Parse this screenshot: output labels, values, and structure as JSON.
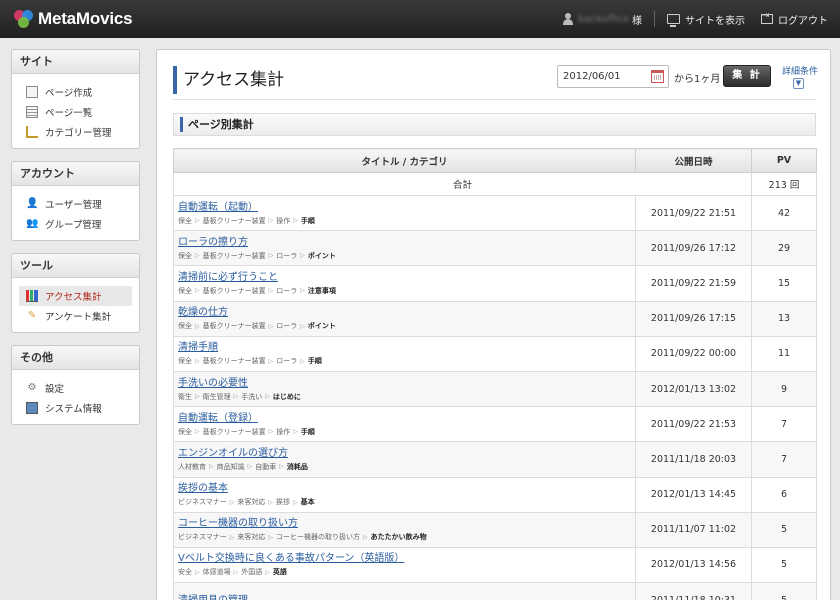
{
  "app": {
    "name": "MetaMovics"
  },
  "header": {
    "username": "backoffice",
    "honorific": "様",
    "view_site": "サイトを表示",
    "logout": "ログアウト"
  },
  "sidebar": [
    {
      "title": "サイト",
      "items": [
        {
          "label": "ページ作成",
          "icon": "page-icon"
        },
        {
          "label": "ページ一覧",
          "icon": "page-list-icon"
        },
        {
          "label": "カテゴリー管理",
          "icon": "category-icon"
        }
      ]
    },
    {
      "title": "アカウント",
      "items": [
        {
          "label": "ユーザー管理",
          "icon": "user-icon"
        },
        {
          "label": "グループ管理",
          "icon": "group-icon"
        }
      ]
    },
    {
      "title": "ツール",
      "items": [
        {
          "label": "アクセス集計",
          "icon": "chart-icon",
          "active": true
        },
        {
          "label": "アンケート集計",
          "icon": "survey-icon"
        }
      ]
    },
    {
      "title": "その他",
      "items": [
        {
          "label": "設定",
          "icon": "gear-icon"
        },
        {
          "label": "システム情報",
          "icon": "system-info-icon"
        }
      ]
    }
  ],
  "main": {
    "title": "アクセス集計",
    "date_value": "2012/06/01",
    "period_label": "から1ヶ月",
    "aggregate_button": "集 計",
    "detail_link": "詳細条件",
    "section_title": "ページ別集計",
    "table": {
      "headers": {
        "title": "タイトル / カテゴリ",
        "date": "公開日時",
        "pv": "PV"
      },
      "total_label": "合計",
      "total_value": "213 回",
      "rows": [
        {
          "title": "自動運転（起動）",
          "crumbs": [
            "保全",
            "基板クリーナー装置",
            "操作",
            "手順"
          ],
          "date": "2011/09/22 21:51",
          "pv": "42"
        },
        {
          "title": "ローラの擦り方",
          "crumbs": [
            "保全",
            "基板クリーナー装置",
            "ローラ",
            "ポイント"
          ],
          "date": "2011/09/26 17:12",
          "pv": "29"
        },
        {
          "title": "清掃前に必ず行うこと",
          "crumbs": [
            "保全",
            "基板クリーナー装置",
            "ローラ",
            "注意事項"
          ],
          "date": "2011/09/22 21:59",
          "pv": "15"
        },
        {
          "title": "乾燥の仕方",
          "crumbs": [
            "保全",
            "基板クリーナー装置",
            "ローラ",
            "ポイント"
          ],
          "date": "2011/09/26 17:15",
          "pv": "13"
        },
        {
          "title": "清掃手順",
          "crumbs": [
            "保全",
            "基板クリーナー装置",
            "ローラ",
            "手順"
          ],
          "date": "2011/09/22 00:00",
          "pv": "11"
        },
        {
          "title": "手洗いの必要性",
          "crumbs": [
            "衛生",
            "衛生管理",
            "手洗い",
            "はじめに"
          ],
          "date": "2012/01/13 13:02",
          "pv": "9"
        },
        {
          "title": "自動運転（登録）",
          "crumbs": [
            "保全",
            "基板クリーナー装置",
            "操作",
            "手順"
          ],
          "date": "2011/09/22 21:53",
          "pv": "7"
        },
        {
          "title": "エンジンオイルの選び方",
          "crumbs": [
            "人材教育",
            "商品知識",
            "自動車",
            "消耗品"
          ],
          "date": "2011/11/18 20:03",
          "pv": "7"
        },
        {
          "title": "挨拶の基本",
          "crumbs": [
            "ビジネスマナー",
            "来客対応",
            "挨拶",
            "基本"
          ],
          "date": "2012/01/13 14:45",
          "pv": "6"
        },
        {
          "title": "コーヒー機器の取り扱い方",
          "crumbs": [
            "ビジネスマナー",
            "来客対応",
            "コーヒー機器の取り扱い方",
            "あたたかい飲み物"
          ],
          "date": "2011/11/07 11:02",
          "pv": "5"
        },
        {
          "title": "Vベルト交換時に良くある事故パターン（英語版）",
          "crumbs": [
            "安全",
            "体感道場",
            "外国語",
            "英語"
          ],
          "date": "2012/01/13 14:56",
          "pv": "5"
        },
        {
          "title": "清掃用具の管理",
          "crumbs": [],
          "date": "2011/11/18 10:31",
          "pv": "5"
        }
      ]
    }
  }
}
